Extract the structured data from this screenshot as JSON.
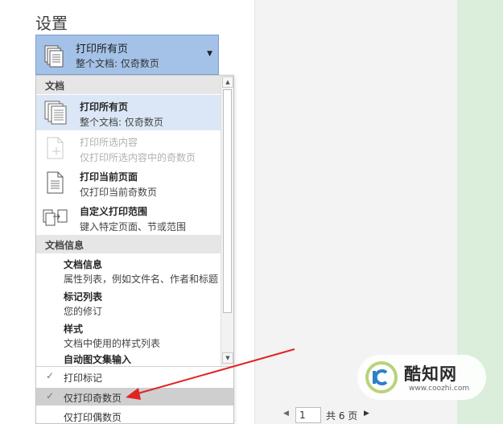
{
  "settings": {
    "title": "设置"
  },
  "dropdown": {
    "selected_title": "打印所有页",
    "selected_subtitle": "整个文档: 仅奇数页",
    "caret_icon": "caret-down-icon"
  },
  "menu": {
    "section_document": "文档",
    "items": [
      {
        "title": "打印所有页",
        "subtitle": "整个文档: 仅奇数页",
        "icon": "pages-stack-icon",
        "state": "selected"
      },
      {
        "title": "打印所选内容",
        "subtitle": "仅打印所选内容中的奇数页",
        "icon": "selection-page-icon",
        "state": "disabled"
      },
      {
        "title": "打印当前页面",
        "subtitle": "仅打印当前奇数页",
        "icon": "single-page-icon",
        "state": "normal"
      },
      {
        "title": "自定义打印范围",
        "subtitle": "键入特定页面、节或范围",
        "icon": "custom-range-icon",
        "state": "normal"
      }
    ],
    "section_doc_info": "文档信息",
    "info_items": [
      {
        "title": "文档信息",
        "subtitle": "属性列表，例如文件名、作者和标题"
      },
      {
        "title": "标记列表",
        "subtitle": "您的修订"
      },
      {
        "title": "样式",
        "subtitle": "文档中使用的样式列表"
      },
      {
        "title": "自动图文集输入",
        "subtitle": ""
      }
    ],
    "options": [
      {
        "label": "打印标记",
        "checked": true,
        "highlighted": false
      },
      {
        "label": "仅打印奇数页",
        "checked": true,
        "highlighted": true
      },
      {
        "label": "仅打印偶数页",
        "checked": false,
        "highlighted": false
      }
    ]
  },
  "pager": {
    "current_page": "1",
    "total_label": "共 6 页"
  },
  "watermark": {
    "brand": "酷知网",
    "url": "www.coozhi.com"
  },
  "colors": {
    "selected_dropdown": "#a4c2e8",
    "arrow": "#e02424",
    "preview_green": "#dbeedb"
  }
}
